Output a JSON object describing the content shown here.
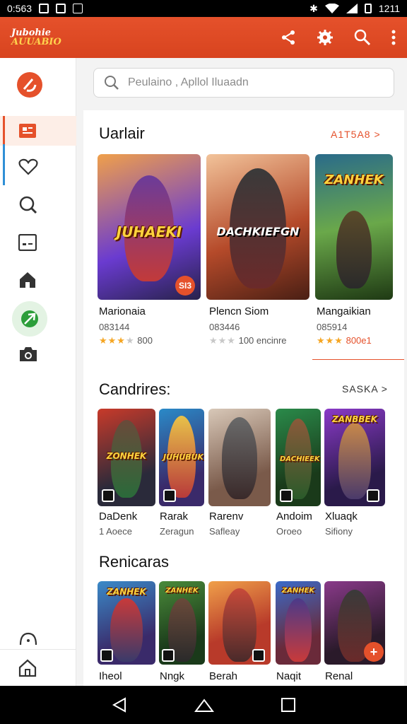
{
  "status_bar": {
    "time": "0:563",
    "clock_right": "1211"
  },
  "app": {
    "logo_line1": "Jubohie",
    "logo_line2": "AUUABIO"
  },
  "search": {
    "placeholder": "Peulaino , Apllol Iluaadn"
  },
  "sections": [
    {
      "title": "Uarlair",
      "link": "A1T5A8 >",
      "cards": [
        {
          "name": "Marionaia",
          "sub": "083144",
          "stars_on": 3,
          "rating": "800",
          "art_title": "JUHAEKI",
          "badge": "SI3"
        },
        {
          "name": "Plencn Siom",
          "sub": "083446",
          "stars_on": 2,
          "rating": "100 encinre",
          "art_title": "DACHKIEFGN"
        },
        {
          "name": "Mangaikian",
          "sub": "085914",
          "stars_on": 3,
          "rating": "800e1",
          "art_title": "ZANHEK"
        }
      ]
    },
    {
      "title": "Candrires:",
      "link": "SASKA >",
      "cards": [
        {
          "name": "DaDenk",
          "sub": "1 Aoece",
          "art_title": "ZONHEK"
        },
        {
          "name": "Rarak",
          "sub": "Zeragun",
          "art_title": "JUHUBUK"
        },
        {
          "name": "Rarenv",
          "sub": "Safleay",
          "art_title": ""
        },
        {
          "name": "Andoim",
          "sub": "Oroeo",
          "art_title": "DACHIEEK"
        },
        {
          "name": "Xluaqk",
          "sub": "Sifiony",
          "art_title": "ZANBBEK"
        }
      ]
    },
    {
      "title": "Renicaras",
      "cards": [
        {
          "name": "Iheol",
          "art_title": "ZANHEK"
        },
        {
          "name": "Nngk",
          "art_title": "ZANHEK"
        },
        {
          "name": "Berah",
          "art_title": ""
        },
        {
          "name": "Naqit",
          "art_title": "ZANHEK"
        },
        {
          "name": "Renal",
          "art_title": ""
        }
      ]
    }
  ],
  "colors": {
    "brand": "#e5512b",
    "accent_blue": "#2f8fd6",
    "star": "#f5a623"
  }
}
